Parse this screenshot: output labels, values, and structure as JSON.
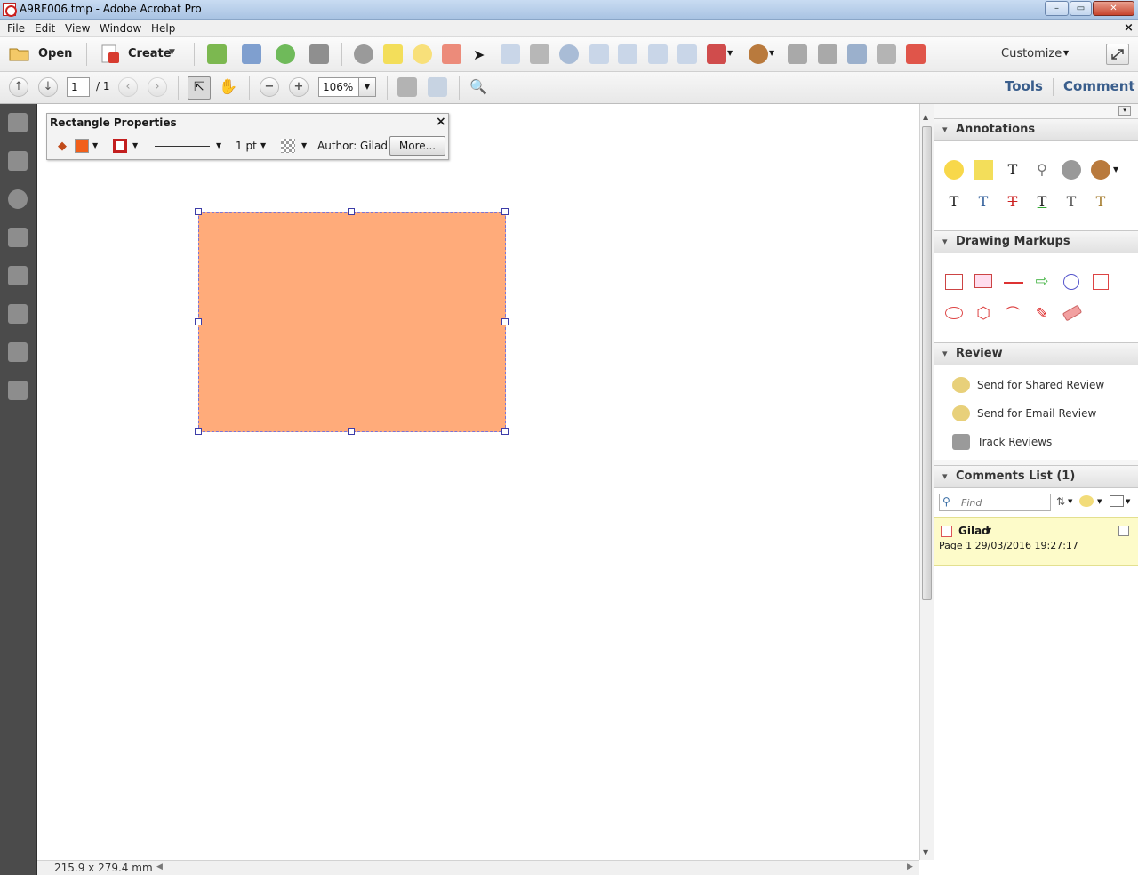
{
  "window": {
    "title": "A9RF006.tmp - Adobe Acrobat Pro",
    "minimize": "–",
    "restore": "▭",
    "close": "✕"
  },
  "menu": [
    "File",
    "Edit",
    "View",
    "Window",
    "Help"
  ],
  "toolbar1": {
    "open_label": "Open",
    "create_label": "Create",
    "customize_label": "Customize"
  },
  "toolbar2": {
    "page_value": "1",
    "page_total": "/ 1",
    "zoom_value": "106%"
  },
  "tabs": {
    "tools": "Tools",
    "comment": "Comment"
  },
  "rect_props": {
    "title": "Rectangle Properties",
    "stroke_width": "1 pt",
    "author": "Author: Gilad",
    "more_button": "More...",
    "close": "×",
    "fill_color": "#f25f1a",
    "stroke_color": "#c31f1f"
  },
  "annotation": {
    "fill_color": "#ffab7a",
    "stroke_color": "#7b74d6"
  },
  "sidebar": {
    "annotations_title": "Annotations",
    "drawing_title": "Drawing Markups",
    "review_title": "Review",
    "review_items": [
      "Send for Shared Review",
      "Send for Email Review",
      "Track Reviews"
    ],
    "comments_title": "Comments List (1)",
    "find_placeholder": "Find",
    "comment": {
      "author": "Gilad",
      "meta": "Page 1  29/03/2016 19:27:17"
    }
  },
  "status": {
    "doc_size": "215.9 x 279.4 mm"
  }
}
